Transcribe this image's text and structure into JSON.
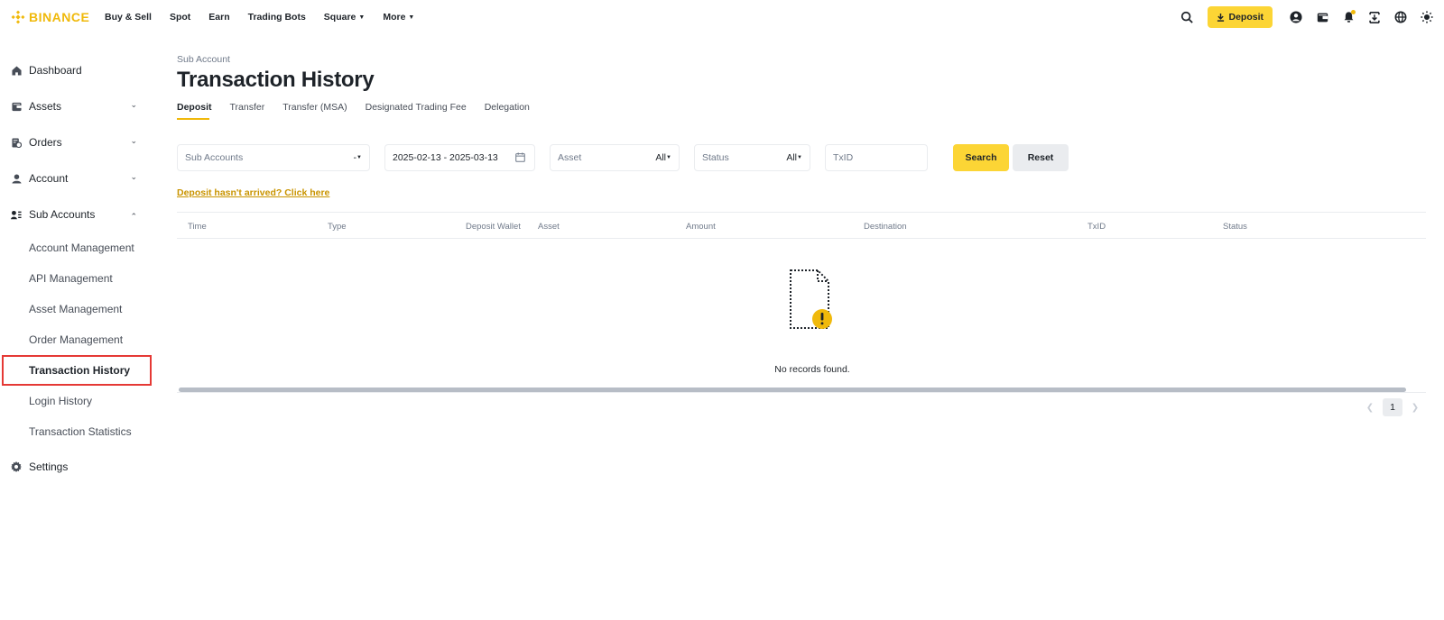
{
  "brand": {
    "name": "BINANCE",
    "color": "#F0B90B"
  },
  "nav": [
    {
      "label": "Buy & Sell",
      "dropdown": false
    },
    {
      "label": "Spot",
      "dropdown": false
    },
    {
      "label": "Earn",
      "dropdown": false
    },
    {
      "label": "Trading Bots",
      "dropdown": false
    },
    {
      "label": "Square",
      "dropdown": true
    },
    {
      "label": "More",
      "dropdown": true
    }
  ],
  "header": {
    "deposit_label": "Deposit",
    "icons": [
      "search-icon",
      "deposit-download-icon",
      "user-profile-icon",
      "wallet-icon",
      "notification-bell-icon",
      "download-app-icon",
      "language-globe-icon",
      "theme-toggle-icon"
    ]
  },
  "sidebar": {
    "items": [
      {
        "label": "Dashboard",
        "icon": "home-icon"
      },
      {
        "label": "Assets",
        "icon": "wallet-icon",
        "chevron": "down"
      },
      {
        "label": "Orders",
        "icon": "orders-icon",
        "chevron": "down"
      },
      {
        "label": "Account",
        "icon": "person-icon",
        "chevron": "down"
      },
      {
        "label": "Sub Accounts",
        "icon": "sub-accounts-icon",
        "chevron": "up"
      }
    ],
    "sub_items": [
      {
        "label": "Account Management"
      },
      {
        "label": "API Management"
      },
      {
        "label": "Asset Management"
      },
      {
        "label": "Order Management"
      },
      {
        "label": "Transaction History",
        "active": true
      },
      {
        "label": "Login History"
      },
      {
        "label": "Transaction Statistics"
      }
    ],
    "settings": {
      "label": "Settings",
      "icon": "gear-icon"
    }
  },
  "main": {
    "breadcrumb": "Sub Account",
    "title": "Transaction History",
    "tabs": [
      {
        "label": "Deposit",
        "active": true
      },
      {
        "label": "Transfer"
      },
      {
        "label": "Transfer (MSA)"
      },
      {
        "label": "Designated Trading Fee"
      },
      {
        "label": "Delegation"
      }
    ],
    "filters": {
      "sub_accounts": {
        "placeholder": "Sub Accounts",
        "value": "-"
      },
      "date_range": "2025-02-13 - 2025-03-13",
      "asset": {
        "label": "Asset",
        "value": "All"
      },
      "status": {
        "label": "Status",
        "value": "All"
      },
      "txid": {
        "placeholder": "TxID"
      },
      "search_label": "Search",
      "reset_label": "Reset"
    },
    "deposit_link": "Deposit hasn't arrived? Click here",
    "table": {
      "columns": [
        "Time",
        "Type",
        "Deposit Wallet",
        "Asset",
        "Amount",
        "Destination",
        "TxID",
        "Status"
      ],
      "rows": [],
      "empty_text": "No records found."
    },
    "pagination": {
      "current_page": "1"
    }
  },
  "colors": {
    "accent": "#FCD535",
    "link": "#C99400",
    "highlight_border": "#e53935"
  }
}
